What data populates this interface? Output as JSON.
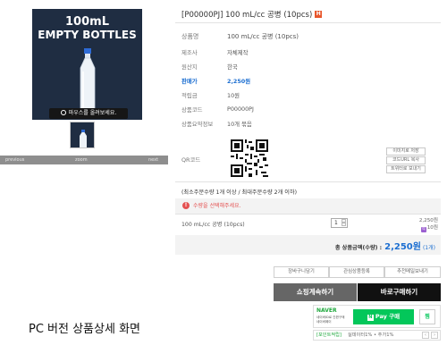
{
  "image_panel": {
    "hero_line1": "100mL",
    "hero_line2": "EMPTY BOTTLES",
    "zoom_hint": "마우스를 올려보세요.",
    "nav_prev": "previous",
    "nav_zoom": "zoom",
    "nav_next": "next",
    "thumb_line1": "100mL",
    "thumb_line2": "EMPTY BOTTLES"
  },
  "product": {
    "title": "[P00000PJ] 100 mL/cc 공병 (10pcs)",
    "hot_badge": "H",
    "info_rows": [
      {
        "label": "상품명",
        "value": "100 mL/cc 공병 (10pcs)"
      },
      {
        "label": "제조사",
        "value": "자체제작"
      },
      {
        "label": "원산지",
        "value": "한국"
      },
      {
        "label": "판매가",
        "value": "2,250원"
      },
      {
        "label": "적립금",
        "value": "10원"
      },
      {
        "label": "상품코드",
        "value": "P00000PJ"
      },
      {
        "label": "상품요약정보",
        "value": "10개 묶음"
      }
    ],
    "qr_label": "QR코드"
  },
  "share_buttons": [
    "이미지로 저장",
    "코드URL 복사",
    "트위터로 보내기"
  ],
  "order": {
    "min_max": "(최소주문수량 1개 이상 / 최대주문수량 2개 이하)",
    "option_warning": "수량을 선택해주세요.",
    "item_name": "100 mL/cc 공병 (10pcs)",
    "quantity": "1",
    "item_price": "2,250원",
    "item_points": "10원",
    "points_badge": "적",
    "total_label": "총 상품금액(수량) :",
    "total_amount": "2,250원",
    "total_count": "(1개)"
  },
  "actions": {
    "cart": "장바구니담기",
    "wishlist": "관심상품등록",
    "recommend": "추천메일보내기",
    "continue": "쇼핑계속하기",
    "buy_now": "바로구매하기"
  },
  "naver_pay": {
    "brand": "NAVER",
    "desc_line1": "네이버ID로 간편구매",
    "desc_line2": "네이버페이",
    "pay_label": "Pay 구매",
    "pay_n": "N",
    "wish_label": "찜"
  },
  "promo": {
    "tag": "[포인트적립]",
    "text": "실데이터1% • 추가1%",
    "prev": "‹",
    "next": "›"
  },
  "caption": "PC 버전 상품상세 화면",
  "colors": {
    "accent_blue": "#1d6fd1",
    "warning_red": "#e45151",
    "naver_green": "#03c75a",
    "hot_orange": "#e8572c"
  }
}
